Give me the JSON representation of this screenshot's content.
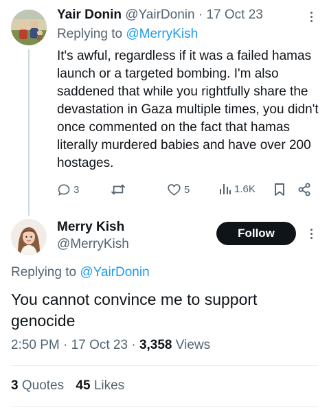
{
  "reply_tweet": {
    "author_name": "Yair Donin",
    "handle": "@YairDonin",
    "separator": "·",
    "date": "17 Oct 23",
    "replying_prefix": "Replying to",
    "replying_to": "@MerryKish",
    "body": "It's awful, regardless if it was a failed hamas launch or a targeted bombing. I'm also saddened that while you rightfully share the devastation in Gaza multiple times, you didn't once commented on the fact that hamas literally murdered babies and have over 200 hostages.",
    "actions": {
      "replies": "3",
      "likes": "5",
      "views": "1.6K"
    }
  },
  "main_tweet": {
    "author_name": "Merry Kish",
    "handle": "@MerryKish",
    "follow_label": "Follow",
    "replying_prefix": "Replying to",
    "replying_to": "@YairDonin",
    "body": "You cannot convince me to support genocide",
    "time": "2:50 PM",
    "sep1": "·",
    "date": "17 Oct 23",
    "sep2": "·",
    "views_count": "3,358",
    "views_label": "Views",
    "quotes_count": "3",
    "quotes_label": "Quotes",
    "likes_count": "45",
    "likes_label": "Likes"
  },
  "colors": {
    "accent": "#1d9bf0",
    "text": "#0f1419",
    "muted": "#536471"
  }
}
